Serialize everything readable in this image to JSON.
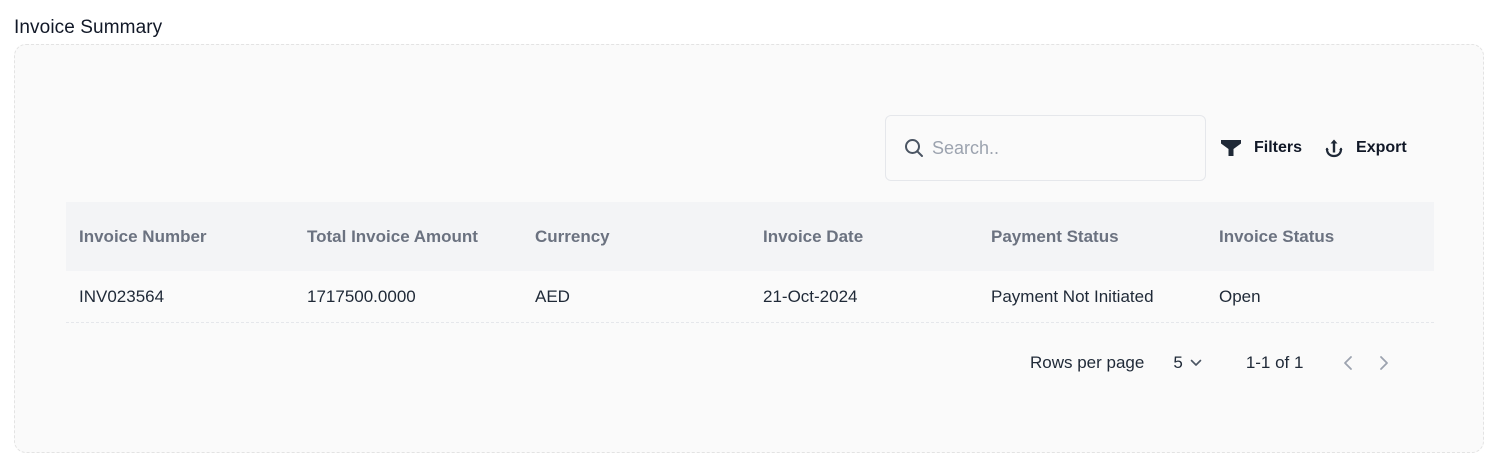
{
  "page": {
    "title": "Invoice Summary"
  },
  "toolbar": {
    "search_placeholder": "Search..",
    "search_value": "",
    "filters_label": "Filters",
    "export_label": "Export"
  },
  "table": {
    "columns": [
      "Invoice Number",
      "Total Invoice Amount",
      "Currency",
      "Invoice Date",
      "Payment Status",
      "Invoice Status"
    ],
    "rows": [
      [
        "INV023564",
        "1717500.0000",
        "AED",
        "21-Oct-2024",
        "Payment Not Initiated",
        "Open"
      ]
    ]
  },
  "pagination": {
    "rows_per_page_label": "Rows per page",
    "rows_per_page_value": "5",
    "range_text": "1-1 of 1"
  },
  "colors": {
    "card_background": "#fafafa",
    "header_background": "#f3f4f6",
    "header_text": "#6b7280",
    "icon_dark": "#1f2937",
    "pager_disabled": "#9ca3af"
  },
  "icons": {
    "search": "search-icon",
    "filters": "funnel-icon",
    "export": "anchor-export-icon",
    "rows_select": "chevron-down-icon",
    "prev": "chevron-left-icon",
    "next": "chevron-right-icon"
  }
}
